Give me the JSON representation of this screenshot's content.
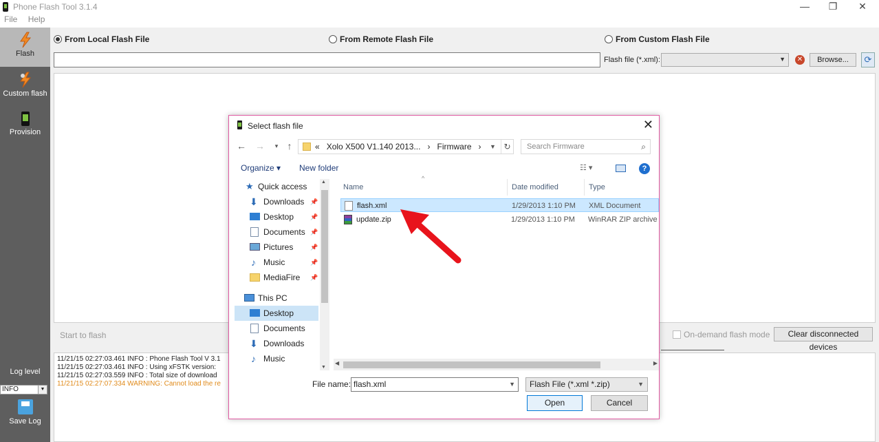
{
  "app": {
    "title": "Phone Flash Tool 3.1.4",
    "menu": [
      "File",
      "Help"
    ],
    "window_buttons": [
      "—",
      "❐",
      "✕"
    ]
  },
  "sidebar": {
    "items": [
      {
        "label": "Flash",
        "icon": "lightning-icon"
      },
      {
        "label": "Custom flash",
        "icon": "custom-flash-icon"
      },
      {
        "label": "Provision",
        "icon": "phone-icon"
      }
    ],
    "log_level_label": "Log level",
    "log_level_value": "INFO",
    "save_log_label": "Save Log"
  },
  "main": {
    "source_options": [
      {
        "label": "From Local Flash File",
        "selected": true
      },
      {
        "label": "From Remote Flash File",
        "selected": false
      },
      {
        "label": "From Custom Flash File",
        "selected": false
      }
    ],
    "path_value": "",
    "flash_file_label": "Flash file (*.xml):",
    "flash_file_value": "",
    "browse_label": "Browse...",
    "start_text": "Start to flash",
    "on_demand_label": "On-demand flash mode",
    "clear_button_label": "Clear disconnected devices",
    "log_lines": [
      {
        "text": "11/21/15 02:27:03.461  INFO   : Phone Flash Tool V 3.1",
        "level": "info"
      },
      {
        "text": "11/21/15 02:27:03.461  INFO   : Using xFSTK version:",
        "level": "info"
      },
      {
        "text": "11/21/15 02:27:03.559  INFO   : Total size of download",
        "level": "info"
      },
      {
        "text": "11/21/15 02:27:07.334  WARNING: Cannot load the re",
        "level": "warn"
      }
    ]
  },
  "dialog": {
    "title": "Select flash file",
    "breadcrumb": [
      "«",
      "Xolo X500 V1.140 2013...",
      "›",
      "Firmware",
      "›"
    ],
    "search_placeholder": "Search Firmware",
    "organize_label": "Organize ▾",
    "new_folder_label": "New folder",
    "nav_items": [
      {
        "label": "Quick access",
        "icon": "star-icon",
        "indent": 0,
        "pinned": false,
        "selected": false
      },
      {
        "label": "Downloads",
        "icon": "download-arrow-icon",
        "indent": 1,
        "pinned": true,
        "selected": false
      },
      {
        "label": "Desktop",
        "icon": "desktop-icon",
        "indent": 1,
        "pinned": true,
        "selected": false
      },
      {
        "label": "Documents",
        "icon": "document-icon",
        "indent": 1,
        "pinned": true,
        "selected": false
      },
      {
        "label": "Pictures",
        "icon": "picture-icon",
        "indent": 1,
        "pinned": true,
        "selected": false
      },
      {
        "label": "Music",
        "icon": "music-note-icon",
        "indent": 1,
        "pinned": true,
        "selected": false
      },
      {
        "label": "MediaFire",
        "icon": "folder-icon",
        "indent": 1,
        "pinned": true,
        "selected": false
      },
      {
        "label": "This PC",
        "icon": "computer-icon",
        "indent": 0,
        "pinned": false,
        "selected": false
      },
      {
        "label": "Desktop",
        "icon": "desktop-icon",
        "indent": 1,
        "pinned": false,
        "selected": true
      },
      {
        "label": "Documents",
        "icon": "document-icon",
        "indent": 1,
        "pinned": false,
        "selected": false
      },
      {
        "label": "Downloads",
        "icon": "download-arrow-icon",
        "indent": 1,
        "pinned": false,
        "selected": false
      },
      {
        "label": "Music",
        "icon": "music-note-icon",
        "indent": 1,
        "pinned": false,
        "selected": false
      }
    ],
    "columns": [
      "Name",
      "Date modified",
      "Type"
    ],
    "files": [
      {
        "name": "flash.xml",
        "date": "1/29/2013 1:10 PM",
        "type": "XML Document",
        "icon": "xml-file-icon",
        "selected": true
      },
      {
        "name": "update.zip",
        "date": "1/29/2013 1:10 PM",
        "type": "WinRAR ZIP archive",
        "icon": "winrar-archive-icon",
        "selected": false
      }
    ],
    "file_name_label": "File name:",
    "file_name_value": "flash.xml",
    "file_type_value": "Flash File (*.xml *.zip)",
    "open_label": "Open",
    "cancel_label": "Cancel"
  },
  "colors": {
    "sidebar_bg": "#5e5e5e",
    "dialog_border": "#e05aa2",
    "annotation_arrow": "#e8141c",
    "selection": "#cce8ff"
  }
}
